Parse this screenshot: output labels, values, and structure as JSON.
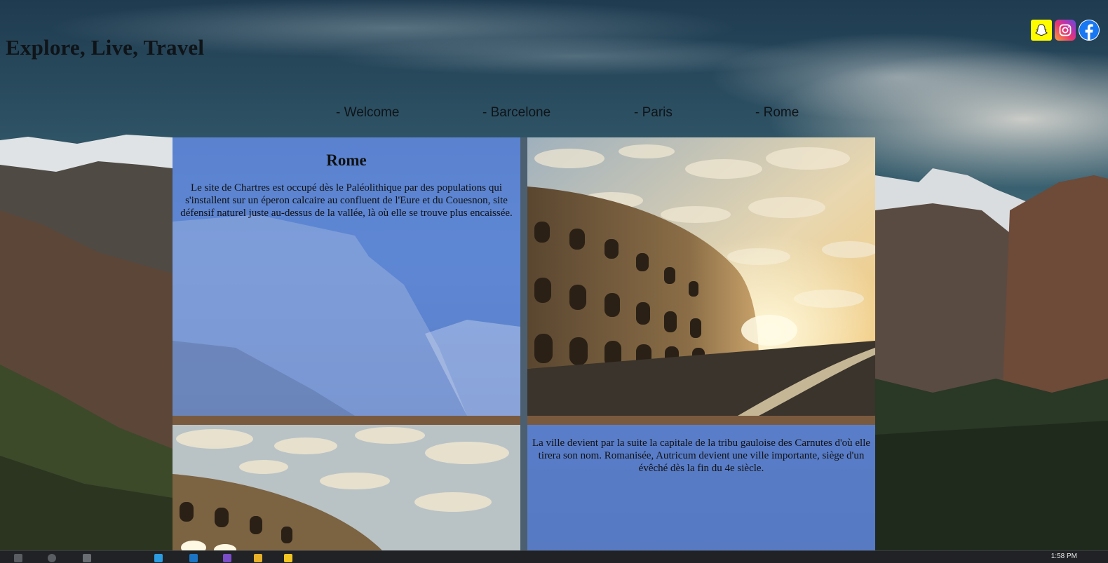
{
  "header": {
    "title": "Explore, Live, Travel"
  },
  "social": [
    {
      "name": "snapchat-icon"
    },
    {
      "name": "instagram-icon"
    },
    {
      "name": "facebook-icon"
    }
  ],
  "nav": {
    "items": [
      {
        "label": "- Welcome"
      },
      {
        "label": "- Barcelone"
      },
      {
        "label": "- Paris"
      },
      {
        "label": "- Rome"
      }
    ]
  },
  "main": {
    "section1": {
      "heading": "Rome",
      "text": "Le site de Chartres est occupé dès le Paléolithique par des populations qui s'installent sur un éperon calcaire au confluent de l'Eure et du Couesnon, site défensif naturel juste au-dessus de la vallée, là où elle se trouve plus encaissée."
    },
    "section2": {
      "text": "La ville devient par la suite la capitale de la tribu gauloise des Carnutes d'où elle tirera son nom. Romanisée, Autricum devient une ville importante, siège d'un évêché dès la fin du 4e siècle."
    }
  },
  "taskbar": {
    "clock": "1:58 PM"
  },
  "colors": {
    "panel_blue": "#648ce6",
    "title_text": "#0f1418",
    "snapchat_yellow": "#fffc00",
    "facebook_blue": "#1877f2"
  }
}
